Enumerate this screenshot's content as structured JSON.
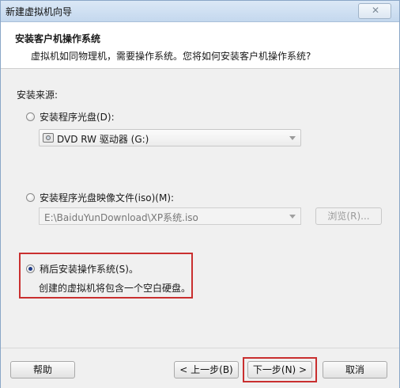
{
  "window": {
    "title": "新建虚拟机向导",
    "close_glyph": "✕"
  },
  "header": {
    "title": "安装客户机操作系统",
    "description": "虚拟机如同物理机，需要操作系统。您将如何安装客户机操作系统?"
  },
  "source": {
    "label": "安装来源:",
    "option_disc": {
      "label": "安装程序光盘(D):",
      "selected": false
    },
    "disc_select": {
      "value": "DVD RW 驱动器 (G:)",
      "icon": "dvd-drive-icon"
    },
    "option_iso": {
      "label": "安装程序光盘映像文件(iso)(M):",
      "selected": false
    },
    "iso_path": {
      "value": "E:\\BaiduYunDownload\\XP系统.iso"
    },
    "browse_label": "浏览(R)...",
    "option_later": {
      "label": "稍后安装操作系统(S)。",
      "selected": true,
      "description": "创建的虚拟机将包含一个空白硬盘。"
    }
  },
  "footer": {
    "help_label": "帮助",
    "back_label": "< 上一步(B)",
    "next_label": "下一步(N) >",
    "cancel_label": "取消"
  },
  "accent_colors": {
    "highlight": "#c92f2f",
    "radio_dot": "#1f3c88"
  }
}
